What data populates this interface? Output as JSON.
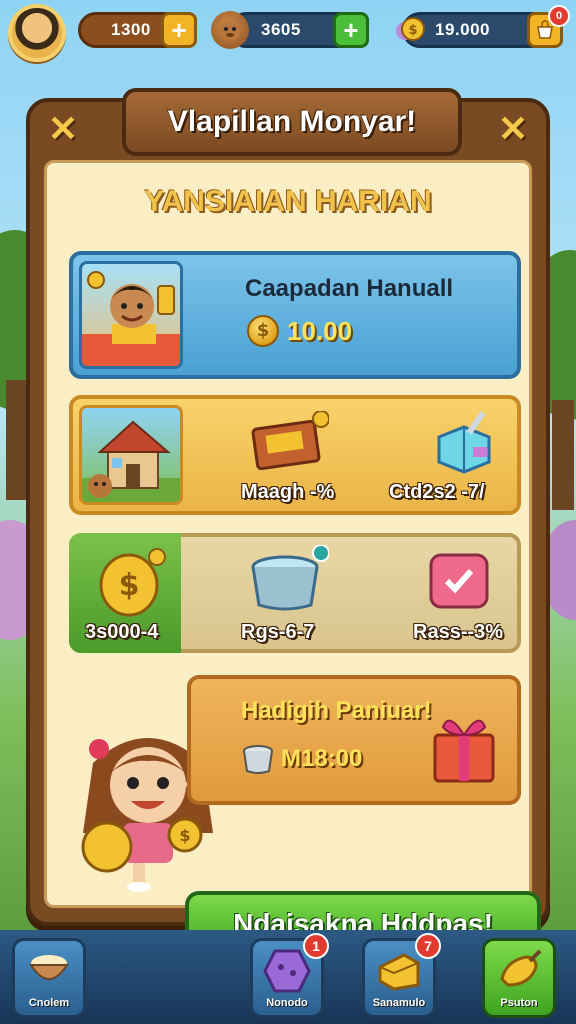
{
  "top_bar": {
    "resources": [
      {
        "value": "1300",
        "icon": "coin-icon"
      },
      {
        "value": "3605",
        "icon": "creature-icon"
      },
      {
        "value": "19.000",
        "icon": "gold-coins-icon"
      }
    ],
    "notification_badge": "0"
  },
  "panel": {
    "title": "Vlapillan Monyar!",
    "subtitle": "YANSIAIAN HARIAN"
  },
  "daily_card": {
    "title": "Caapadan Hanuall",
    "amount": "10.00"
  },
  "reward_row_1": [
    {
      "label": "Maagh -%",
      "icon": "book-icon"
    },
    {
      "label": "Ctd2s2 -7/",
      "icon": "crystal-box-icon"
    }
  ],
  "reward_row_2": [
    {
      "label": "3s000-4",
      "icon": "big-coin-icon"
    },
    {
      "label": "Rgs-6-7",
      "icon": "water-tub-icon"
    },
    {
      "label": "Rass--3%",
      "icon": "pink-ticket-icon"
    }
  ],
  "special_card": {
    "title": "Hadigih Paniuar!",
    "amount": "M18:00"
  },
  "claim_button": "Ndaisakna Hddpas!",
  "bottom_nav": [
    {
      "label": "Cnolem",
      "icon": "rice-bowl-icon",
      "badge": ""
    },
    {
      "label": "Nonodo",
      "icon": "purple-gem-icon",
      "badge": "1"
    },
    {
      "label": "Sanamulo",
      "icon": "cheese-block-icon",
      "badge": "7"
    },
    {
      "label": "Psuton",
      "icon": "golden-shovel-icon",
      "badge": ""
    }
  ]
}
